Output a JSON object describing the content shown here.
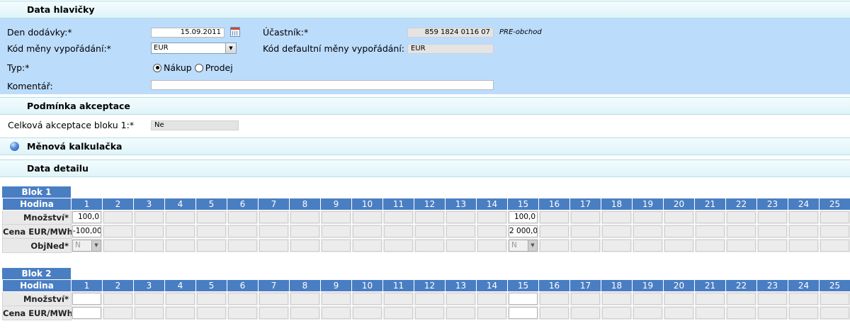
{
  "header_section": {
    "title": "Data hlavičky",
    "den_dodavky": {
      "label": "Den dodávky:*",
      "value": "15.09.2011"
    },
    "ucastnik": {
      "label": "Účastník:*",
      "value": "859 1824 0116 07",
      "note": "PRE-obchod"
    },
    "kod_meny": {
      "label": "Kód měny vypořádání:*",
      "value": "EUR"
    },
    "kod_default": {
      "label": "Kód defaultní měny vypořádání:",
      "value": "EUR"
    },
    "typ": {
      "label": "Typ:*",
      "options": [
        "Nákup",
        "Prodej"
      ],
      "selected": "Nákup"
    },
    "komentar": {
      "label": "Komentář:",
      "value": ""
    }
  },
  "acceptance_section": {
    "title": "Podmínka akceptace",
    "celkova": {
      "label": "Celková akceptace bloku 1:*",
      "value": "Ne"
    }
  },
  "calculator_section": {
    "title": "Měnová kalkulačka",
    "icon": "globe-icon"
  },
  "detail_section": {
    "title": "Data detailu"
  },
  "hours": [
    "1",
    "2",
    "3",
    "4",
    "5",
    "6",
    "7",
    "8",
    "9",
    "10",
    "11",
    "12",
    "13",
    "14",
    "15",
    "16",
    "17",
    "18",
    "19",
    "20",
    "21",
    "22",
    "23",
    "24",
    "25"
  ],
  "blocks": [
    {
      "title": "Blok 1",
      "hour_label": "Hodina",
      "rows": [
        {
          "label": "Množství*",
          "kind": "input",
          "values": {
            "1": "100,0",
            "15": "100,0"
          }
        },
        {
          "label": "Cena EUR/MWh*",
          "kind": "input",
          "values": {
            "1": "-100,00",
            "15": "2 000,00"
          }
        },
        {
          "label": "ObjNed*",
          "kind": "select",
          "values": {
            "1": "N",
            "15": "N"
          }
        }
      ]
    },
    {
      "title": "Blok 2",
      "hour_label": "Hodina",
      "rows": [
        {
          "label": "Množství*",
          "kind": "input",
          "values": {
            "1": "",
            "15": ""
          }
        },
        {
          "label": "Cena EUR/MWh*",
          "kind": "input",
          "values": {
            "1": "",
            "15": ""
          }
        }
      ]
    }
  ],
  "colors": {
    "panel": "#bcdcfc",
    "header_blue": "#4a7ec3",
    "section_band": "#dff4f8"
  }
}
